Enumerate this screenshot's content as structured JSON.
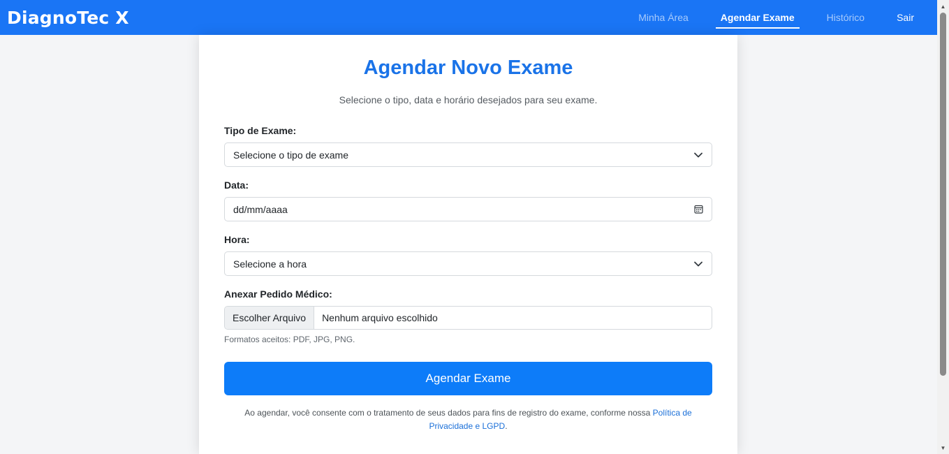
{
  "nav": {
    "brand": "DiagnoTec X",
    "links": [
      {
        "label": "Minha Área",
        "active": false
      },
      {
        "label": "Agendar Exame",
        "active": true
      },
      {
        "label": "Histórico",
        "active": false
      },
      {
        "label": "Sair",
        "active": false
      }
    ]
  },
  "form": {
    "title": "Agendar Novo Exame",
    "subtitle": "Selecione o tipo, data e horário desejados para seu exame.",
    "exam_type": {
      "label": "Tipo de Exame:",
      "value": "Selecione o tipo de exame",
      "icon": "chevron-down-icon"
    },
    "date": {
      "label": "Data:",
      "value": "dd/mm/aaaa",
      "icon": "calendar-icon"
    },
    "time": {
      "label": "Hora:",
      "value": "Selecione a hora",
      "icon": "chevron-down-icon"
    },
    "attachment": {
      "label": "Anexar Pedido Médico:",
      "button": "Escolher Arquivo",
      "file_name": "Nenhum arquivo escolhido",
      "hint": "Formatos aceitos: PDF, JPG, PNG."
    },
    "submit_label": "Agendar Exame",
    "consent_text": "Ao agendar, você consente com o tratamento de seus dados para fins de registro do exame, conforme nossa ",
    "consent_link": "Política de Privacidade e LGPD",
    "consent_end": "."
  },
  "colors": {
    "primary": "#1a75f5",
    "button": "#0d7cf9",
    "title": "#1a73e8",
    "background": "#f4f5f7"
  }
}
